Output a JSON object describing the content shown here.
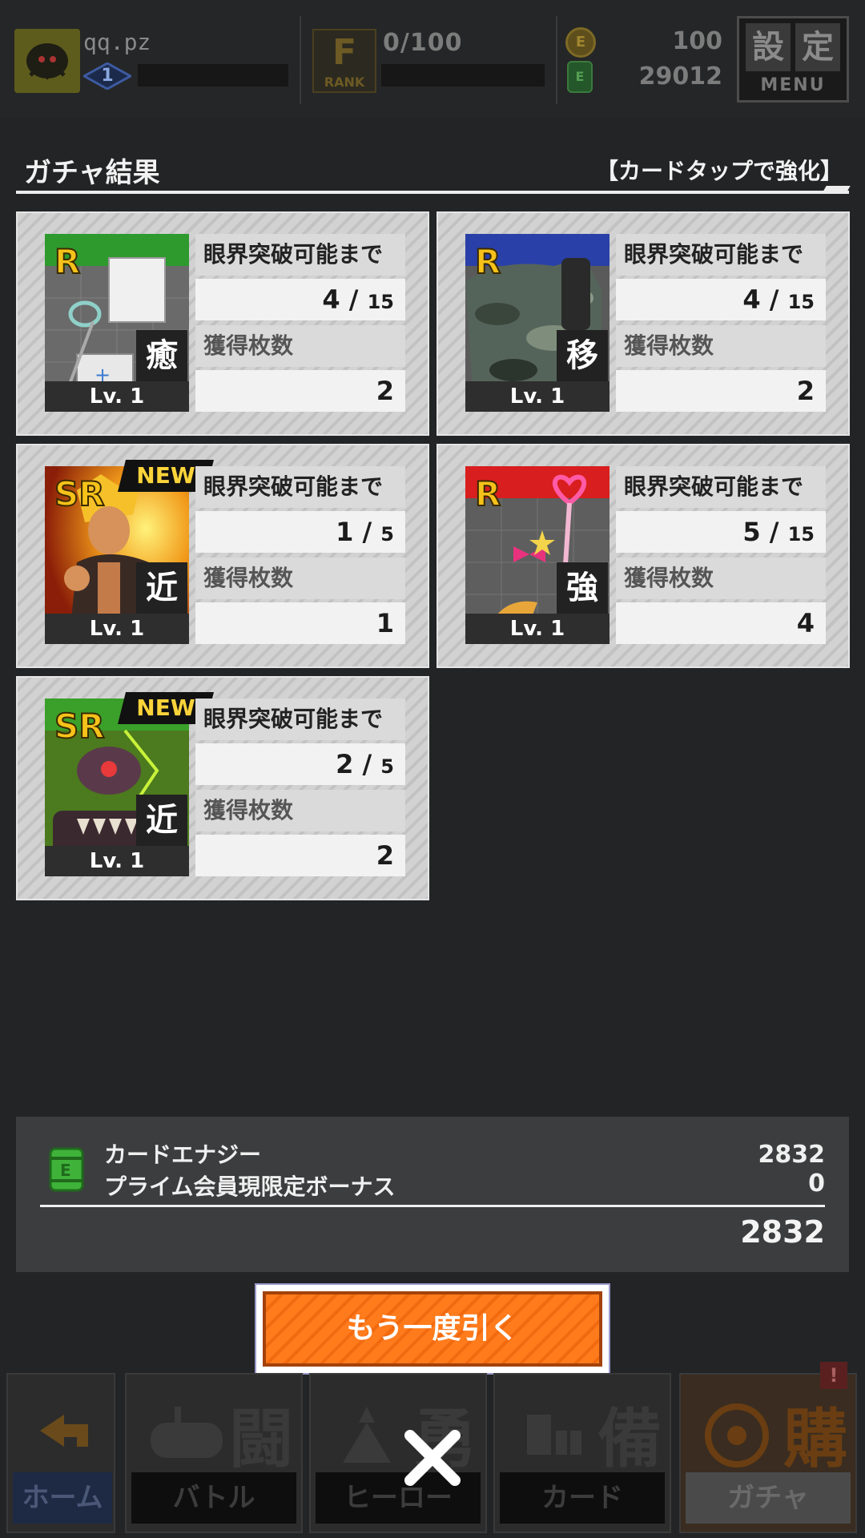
{
  "header": {
    "player_name": "qq.pz",
    "player_level": "1",
    "rank_letter": "F",
    "rank_label": "RANK",
    "rank_progress": "0/100",
    "coin_symbol": "E",
    "coins": "100",
    "energy_symbol": "E",
    "energy": "29012",
    "menu_kanji_1": "設",
    "menu_kanji_2": "定",
    "menu_label": "MENU"
  },
  "section": {
    "title": "ガチャ結果",
    "hint": "【カードタップで強化】"
  },
  "labels": {
    "limit_break": "眼界突破可能まで",
    "owned_count": "獲得枚数",
    "slash": "/"
  },
  "cards": [
    {
      "rarity": "R",
      "type": "癒",
      "level": "Lv. 1",
      "is_new": false,
      "progress": "4",
      "required": "15",
      "owned": "2",
      "art": "medical-kit"
    },
    {
      "rarity": "R",
      "type": "移",
      "level": "Lv. 1",
      "is_new": false,
      "progress": "4",
      "required": "15",
      "owned": "2",
      "art": "camo-pouch"
    },
    {
      "rarity": "SR",
      "type": "近",
      "level": "Lv. 1",
      "is_new": true,
      "new_label": "NEW",
      "progress": "1",
      "required": "5",
      "owned": "1",
      "art": "blonde-fighter"
    },
    {
      "rarity": "R",
      "type": "強",
      "level": "Lv. 1",
      "is_new": false,
      "progress": "5",
      "required": "15",
      "owned": "4",
      "art": "magic-heart-wand"
    },
    {
      "rarity": "SR",
      "type": "近",
      "level": "Lv. 1",
      "is_new": true,
      "new_label": "NEW",
      "progress": "2",
      "required": "5",
      "owned": "2",
      "art": "green-robot"
    }
  ],
  "energy_summary": {
    "card_energy_label": "カードエナジー",
    "card_energy_value": "2832",
    "bonus_label": "プライム会員現限定ボーナス",
    "bonus_value": "0",
    "total": "2832"
  },
  "draw_again_label": "もう一度引く",
  "nav": {
    "home": "ホーム",
    "battle": "バトル",
    "hero": "ヒーロー",
    "card": "カード",
    "gacha": "ガチャ",
    "battle_kanji": "闘",
    "hero_kanji": "勇",
    "card_kanji": "備",
    "gacha_kanji": "購",
    "alert": "!"
  },
  "colors": {
    "accent_orange": "#ff7b1c",
    "rarity_gold": "#f6c21a",
    "new_yellow": "#fbd43a",
    "background": "#232425"
  }
}
